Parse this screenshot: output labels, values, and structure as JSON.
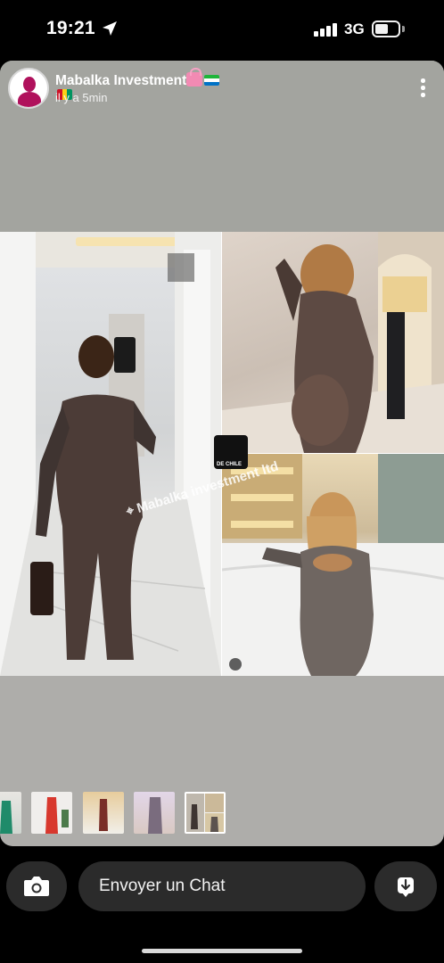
{
  "status_bar": {
    "time": "19:21",
    "network": "3G"
  },
  "story": {
    "account_name": "Mabalka Investment",
    "post_time": "il y a 5min",
    "watermark_text": "Mabalka investment ltd",
    "watermark_logo_text": "DE CHILE"
  },
  "chat": {
    "placeholder": "Envoyer un Chat"
  },
  "colors": {
    "background": "#000000",
    "story_bg": "#aeadaa",
    "header_bg": "#a3a49f",
    "avatar": "#b0115c",
    "control_bg": "#2b2b2b"
  },
  "icons": [
    "location-arrow-icon",
    "signal-icon",
    "battery-icon",
    "more-vertical-icon",
    "camera-icon",
    "reply-icon",
    "shopping-bag-icon"
  ]
}
